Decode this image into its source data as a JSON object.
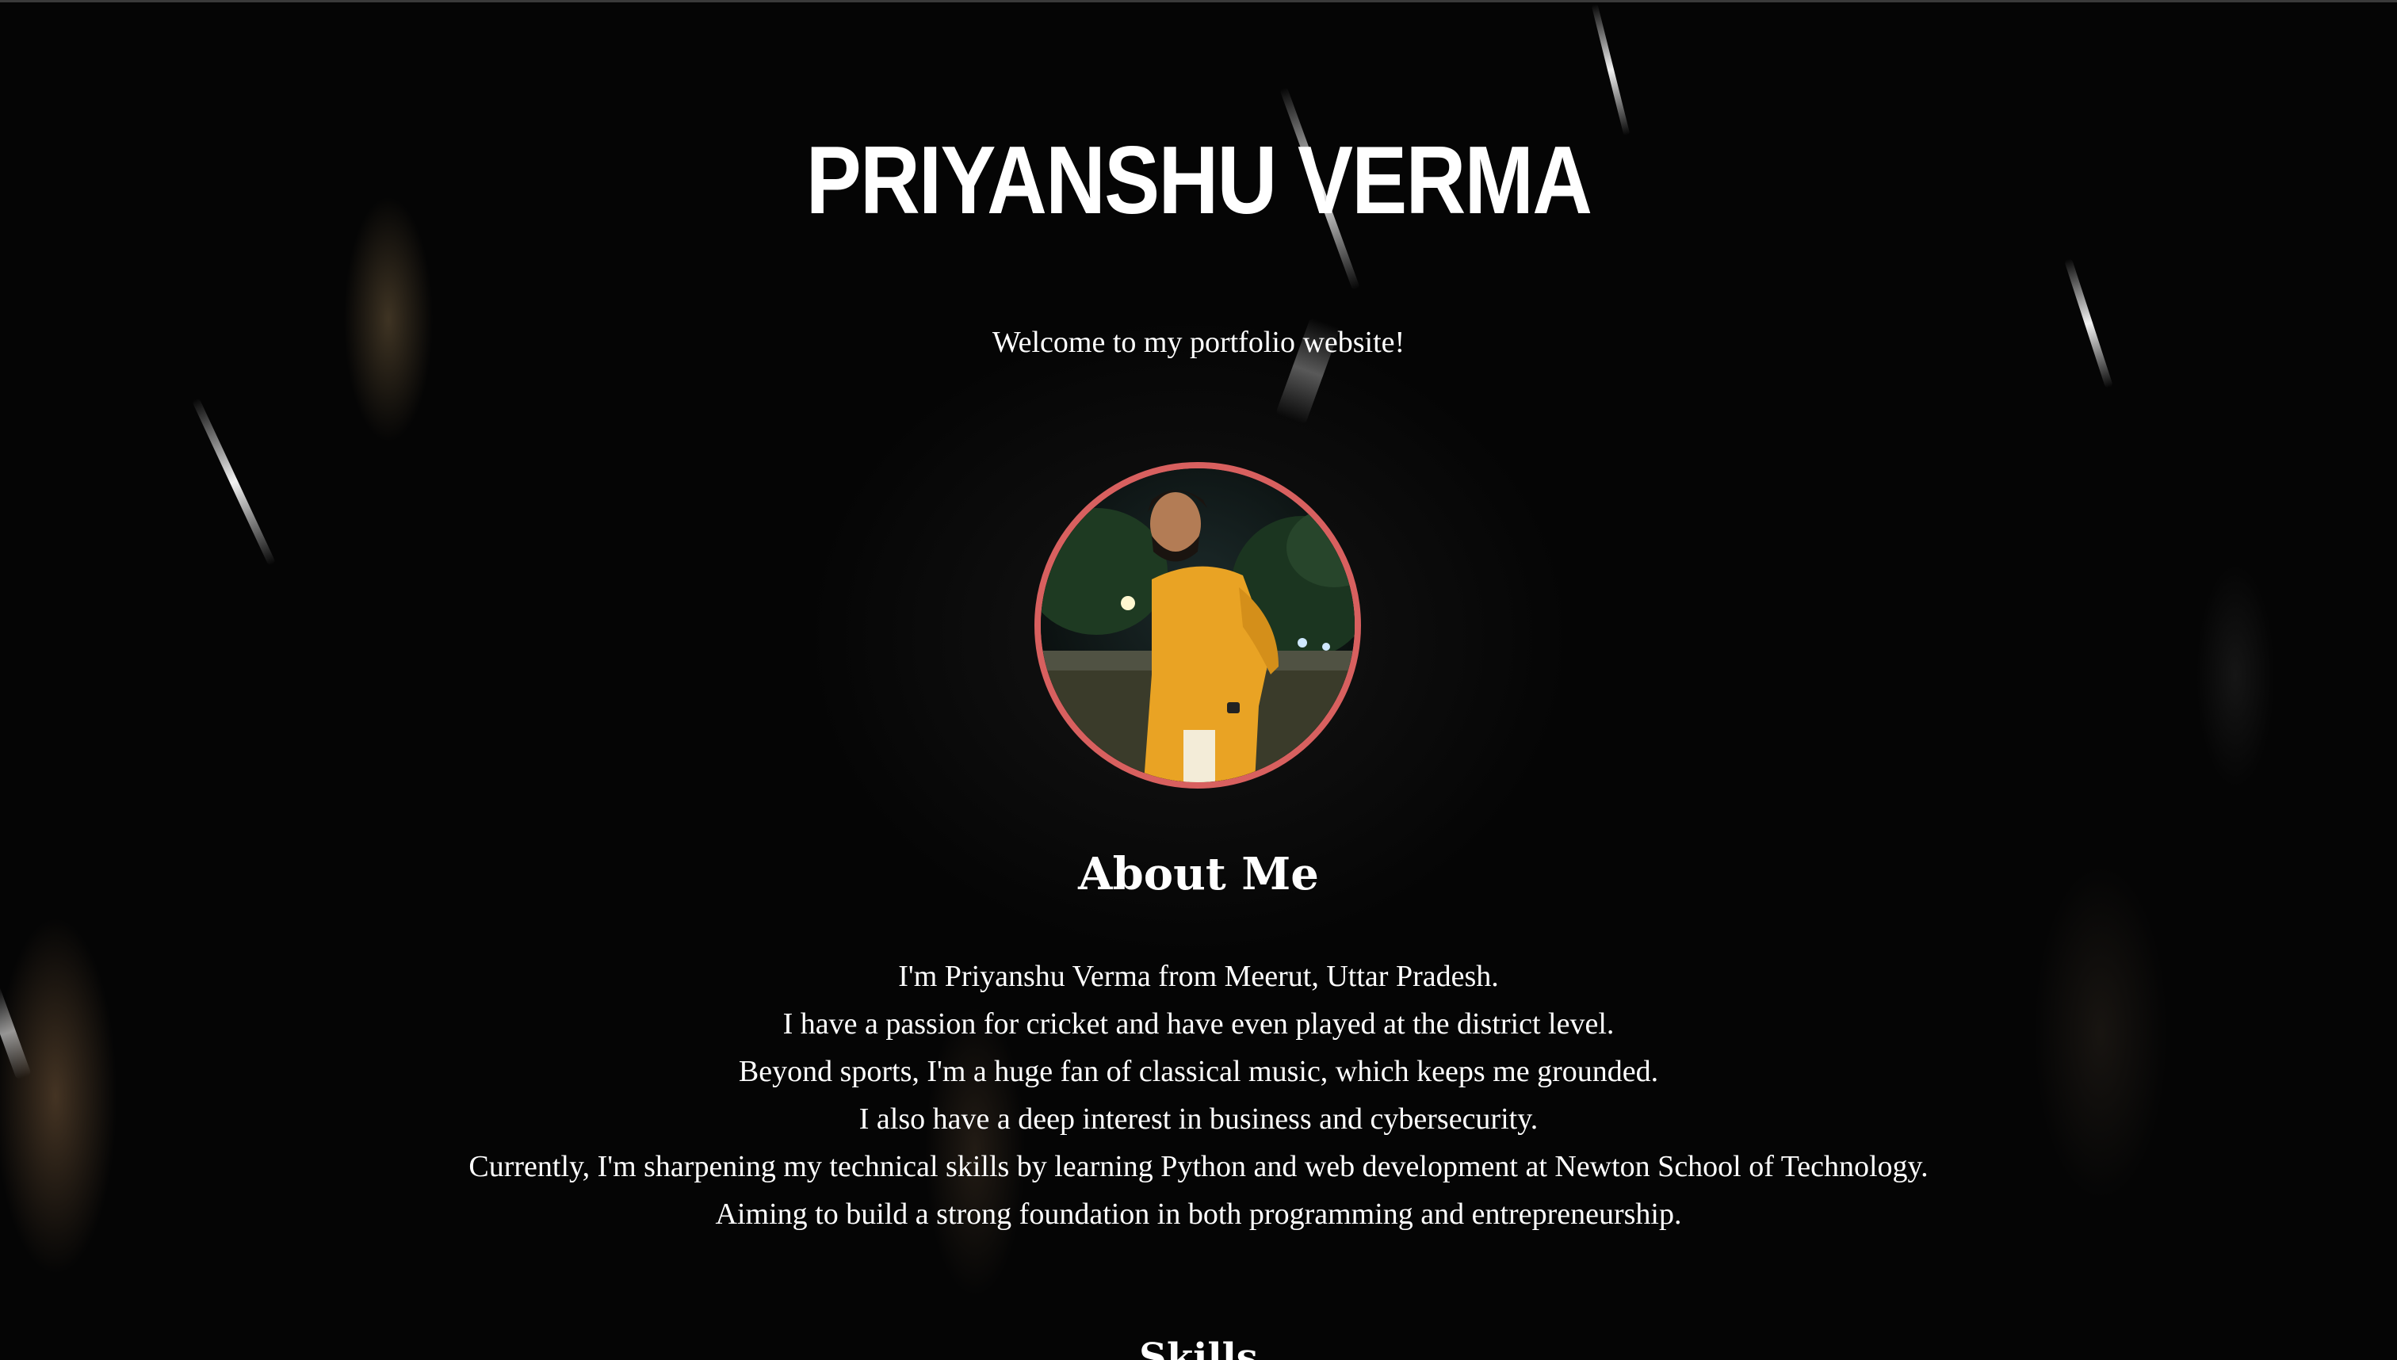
{
  "header": {
    "title": "PRIYANSHU VERMA",
    "welcome": "Welcome to my portfolio website!"
  },
  "profile": {
    "photo_icon": "profile-photo",
    "border_color": "#d8605f"
  },
  "about": {
    "heading": "About Me",
    "lines": [
      "I'm Priyanshu Verma from Meerut, Uttar Pradesh.",
      "I have a passion for cricket and have even played at the district level.",
      "Beyond sports, I'm a huge fan of classical music, which keeps me grounded.",
      "I also have a deep interest in business and cybersecurity.",
      "Currently, I'm sharpening my technical skills by learning Python and web development at Newton School of Technology.",
      "Aiming to build a strong foundation in both programming and entrepreneurship."
    ]
  },
  "skills": {
    "heading": "Skills"
  },
  "colors": {
    "background": "#050505",
    "text": "#ffffff",
    "accent": "#d8605f"
  }
}
